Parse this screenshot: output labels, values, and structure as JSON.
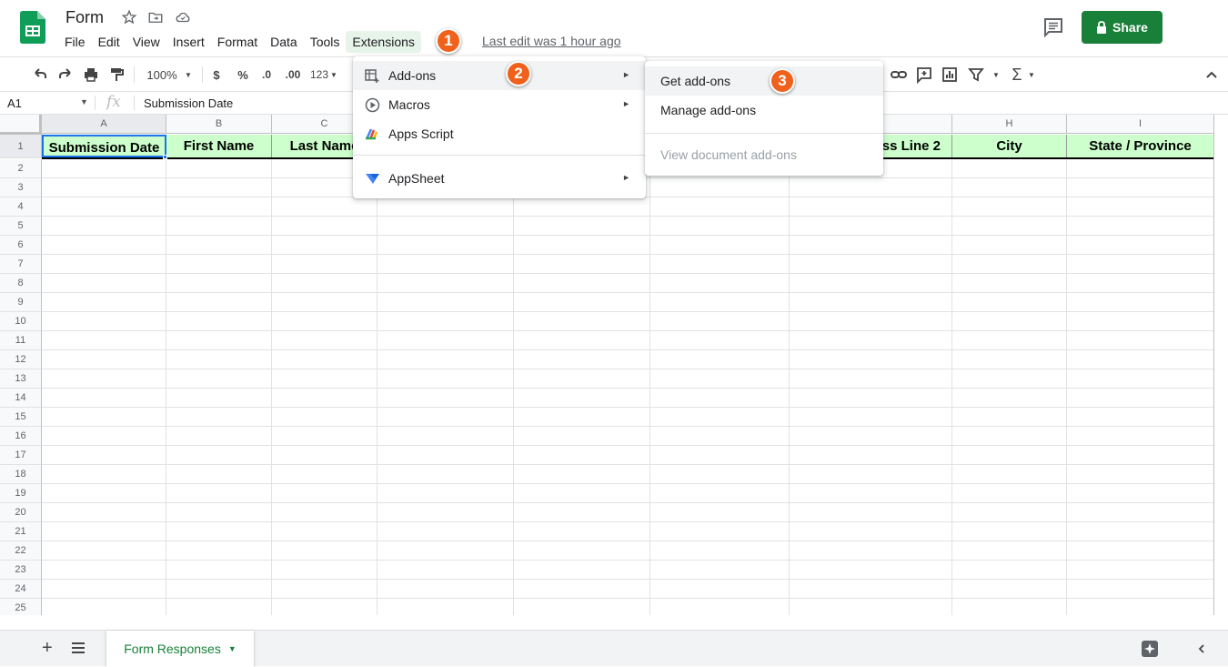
{
  "document": {
    "title": "Form",
    "last_edit": "Last edit was 1 hour ago"
  },
  "menubar": {
    "items": [
      "File",
      "Edit",
      "View",
      "Insert",
      "Format",
      "Data",
      "Tools",
      "Extensions"
    ]
  },
  "share_button": {
    "label": "Share"
  },
  "toolbar": {
    "zoom": "100%",
    "currency": "$",
    "percent": "%",
    "decrease_decimals": ".0",
    "increase_decimals": ".00",
    "more_formats": "123"
  },
  "formula_bar": {
    "name_box": "A1",
    "fx": "fx",
    "content": "Submission Date"
  },
  "grid": {
    "columns": [
      "A",
      "B",
      "C",
      "H",
      "I"
    ],
    "header_row": {
      "row_number": "1",
      "cells": [
        "Submission Date",
        "First Name",
        "Last Name",
        "ss Line 2",
        "City",
        "State / Province"
      ]
    },
    "row_numbers": [
      "2",
      "3",
      "4",
      "5",
      "6",
      "7",
      "8",
      "9",
      "10",
      "11",
      "12",
      "13",
      "14",
      "15",
      "16",
      "17",
      "18",
      "19",
      "20",
      "21",
      "22",
      "23",
      "24",
      "25"
    ]
  },
  "extensions_menu": {
    "items": [
      {
        "label": "Add-ons",
        "icon": "addons-icon",
        "submenu": true
      },
      {
        "label": "Macros",
        "icon": "macros-icon",
        "submenu": true
      },
      {
        "label": "Apps Script",
        "icon": "apps-script-icon",
        "submenu": false
      },
      {
        "label": "AppSheet",
        "icon": "appsheet-icon",
        "submenu": true
      }
    ]
  },
  "addons_submenu": {
    "items": [
      {
        "label": "Get add-ons",
        "disabled": false
      },
      {
        "label": "Manage add-ons",
        "disabled": false
      },
      {
        "label": "View document add-ons",
        "disabled": true
      }
    ]
  },
  "annotations": [
    "1",
    "2",
    "3"
  ],
  "sheet_tabs": [
    {
      "label": "Form Responses",
      "active": true
    }
  ],
  "colors": {
    "share": "#188038",
    "header_fill": "#ccffcc",
    "badge": "#f0611c",
    "active_menu": "#e6f4ea"
  }
}
